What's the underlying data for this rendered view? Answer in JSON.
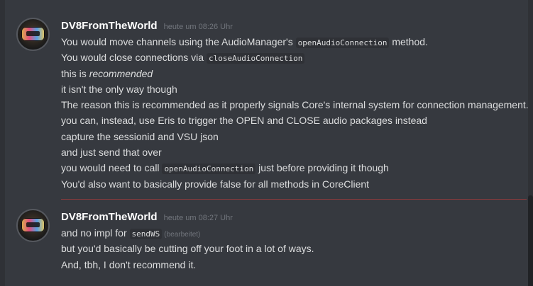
{
  "messages": [
    {
      "author": "DV8FromTheWorld",
      "timestamp": "heute um 08:26 Uhr",
      "lines": {
        "l1a": "You would move channels using the AudioManager's ",
        "l1code": "openAudioConnection",
        "l1b": " method.",
        "l2a": "You would close connections via ",
        "l2code": "closeAudioConnection",
        "l3a": "this is ",
        "l3em": "recommended",
        "l4": "it isn't the only way though",
        "l5": "The reason this is recommended as it properly signals Core's internal system for connection management.",
        "l6": "you can, instead, use Eris to trigger the OPEN and CLOSE audio packages instead",
        "l7": "capture the sessionid and VSU json",
        "l8": "and just send that over",
        "l9a": "you would need to call ",
        "l9code": "openAudioConnection",
        "l9b": " just before providing it though",
        "l10": "You'd also want to basically provide false for all methods in CoreClient"
      }
    },
    {
      "author": "DV8FromTheWorld",
      "timestamp": "heute um 08:27 Uhr",
      "lines": {
        "l1a": "and no impl for ",
        "l1code": "sendWS",
        "l1edited": "(bearbeitet)",
        "l2": "but you'd basically be cutting off your foot in a lot of ways.",
        "l3": "And, tbh, I don't recommend it."
      }
    }
  ],
  "colors": {
    "background": "#36393f",
    "username": "#ffffff",
    "text": "#dcddde",
    "timestamp": "#72767d",
    "new_divider": "#f04747"
  }
}
